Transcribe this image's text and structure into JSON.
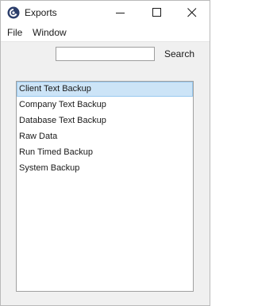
{
  "window": {
    "title": "Exports"
  },
  "menu": {
    "file": "File",
    "window": "Window"
  },
  "search": {
    "value": "",
    "placeholder": "",
    "button_label": "Search"
  },
  "list": {
    "items": [
      {
        "label": "Client Text Backup",
        "selected": true
      },
      {
        "label": "Company Text Backup",
        "selected": false
      },
      {
        "label": "Database Text Backup",
        "selected": false
      },
      {
        "label": "Raw Data",
        "selected": false
      },
      {
        "label": "Run Timed Backup",
        "selected": false
      },
      {
        "label": "System Backup",
        "selected": false
      }
    ]
  },
  "icons": {
    "app": "app-logo-icon",
    "minimize": "minimize-icon",
    "maximize": "maximize-icon",
    "close": "close-icon"
  },
  "colors": {
    "selection_bg": "#cce4f7",
    "selection_border": "#99c9ef",
    "window_bg": "#f0f0f0"
  }
}
